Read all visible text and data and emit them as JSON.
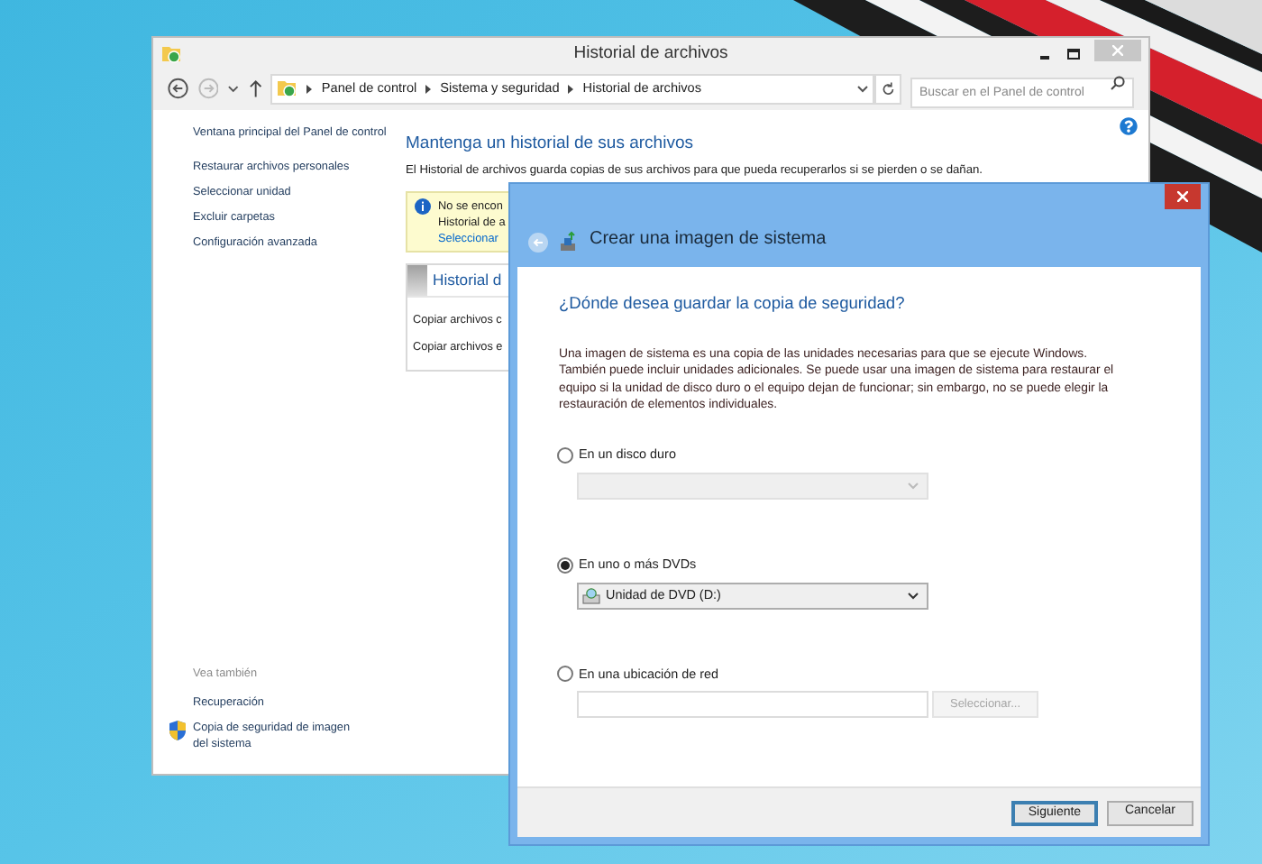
{
  "main_window": {
    "title": "Historial de archivos",
    "breadcrumb": [
      "Panel de control",
      "Sistema y seguridad",
      "Historial de archivos"
    ],
    "search": {
      "placeholder": "Buscar en el Panel de control"
    },
    "sidebar": {
      "items": [
        "Ventana principal del Panel de control",
        "Restaurar archivos personales",
        "Seleccionar unidad",
        "Excluir carpetas",
        "Configuración avanzada"
      ],
      "see_also_heading": "Vea también",
      "see_also": [
        {
          "label": "Recuperación",
          "kind": "link"
        },
        {
          "label": "Copia de seguridad de imagen del sistema",
          "kind": "shield"
        }
      ]
    },
    "heading": "Mantenga un historial de sus archivos",
    "description": "El Historial de archivos guarda copias de sus archivos para que pueda recuperarlos si se pierden o se dañan.",
    "notice": {
      "lines": [
        "No se encon",
        "Historial de a"
      ],
      "link": "Seleccionar"
    },
    "panel": {
      "title": "Historial d",
      "rows": [
        "Copiar archivos c",
        "Copiar archivos e"
      ]
    }
  },
  "dialog": {
    "title": "Crear una imagen de sistema",
    "heading": "¿Dónde desea guardar la copia de seguridad?",
    "description": "Una imagen de sistema es una copia de las unidades necesarias para que se ejecute Windows. También puede incluir unidades adicionales. Se puede usar una imagen de sistema para restaurar el equipo si la unidad de disco duro o el equipo dejan de funcionar; sin embargo, no se puede elegir la restauración de elementos individuales.",
    "options": [
      {
        "label": "En un disco duro",
        "selected": false,
        "kind": "dropdown",
        "disabled": true
      },
      {
        "label": "En uno o más DVDs",
        "selected": true,
        "kind": "dropdown",
        "disabled": false,
        "value": "Unidad de DVD (D:)"
      },
      {
        "label": "En una ubicación de red",
        "selected": false,
        "kind": "path",
        "disabled": true,
        "button": "Seleccionar..."
      }
    ],
    "buttons": [
      {
        "label": "Siguiente",
        "default": true
      },
      {
        "label": "Cancelar",
        "default": false
      }
    ]
  }
}
